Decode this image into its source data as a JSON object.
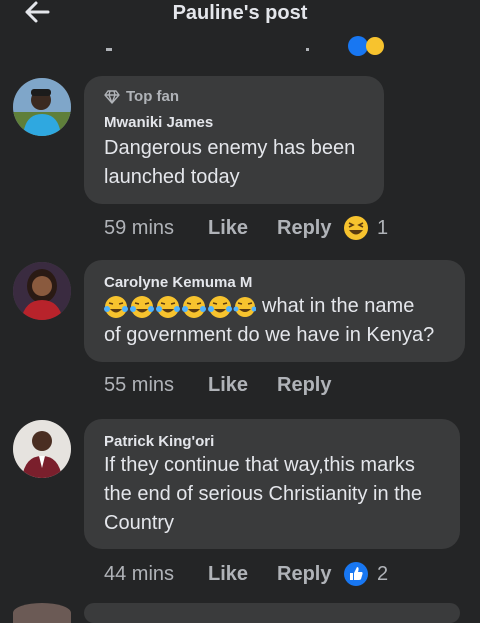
{
  "header": {
    "title": "Pauline's post"
  },
  "comments": [
    {
      "badge": "Top fan",
      "author": "Mwaniki James",
      "lines": [
        "Dangerous enemy has been",
        "launched today"
      ],
      "time": "59 mins",
      "like_label": "Like",
      "reply_label": "Reply",
      "reaction": "laugh",
      "reaction_count": "1"
    },
    {
      "author": "Carolyne Kemuma M",
      "lines": [
        "what in the name",
        "of government do we have in Kenya?"
      ],
      "time": "55 mins",
      "like_label": "Like",
      "reply_label": "Reply"
    },
    {
      "author": "Patrick King'ori",
      "lines": [
        "If they continue that way,this marks",
        "the end of serious Christianity in the",
        "Country"
      ],
      "time": "44 mins",
      "like_label": "Like",
      "reply_label": "Reply",
      "reaction": "like",
      "reaction_count": "2"
    }
  ],
  "colors": {
    "background": "#242526",
    "bubble": "#3a3b3c",
    "text": "#e4e6eb",
    "muted": "#b0b3b8",
    "like_blue": "#1877f2",
    "emoji_yellow": "#f7c32e"
  }
}
